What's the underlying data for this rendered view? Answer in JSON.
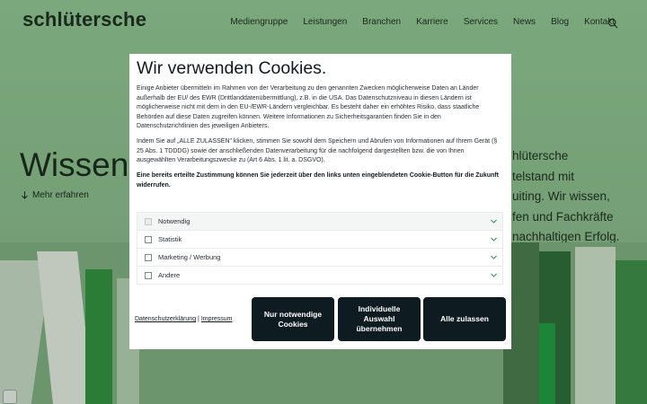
{
  "header": {
    "logo": "schlütersche",
    "nav": [
      "Mediengruppe",
      "Leistungen",
      "Branchen",
      "Karriere",
      "Services",
      "News",
      "Blog",
      "Kontakt"
    ]
  },
  "hero": {
    "title": "Wissen",
    "more_link": "Mehr erfahren",
    "side_lines": [
      "hlütersche",
      "telstand mit",
      "uiting. Wir wissen,",
      "fen und Fachkräfte",
      "nachhaltigen Erfolg."
    ]
  },
  "cookie_dialog": {
    "title": "Wir verwenden Cookies.",
    "paragraphs": [
      "Einige Anbieter übermitteln im Rahmen von der Verarbeitung zu den genannten Zwecken möglicherweise Daten an Länder außerhalb der EU/ des EWR (Drittlanddatenübermittlung), z.B. in die USA. Das Datenschutzniveau in diesen Ländern ist möglicherweise nicht mit dem in den EU-/EWR-Ländern vergleichbar. Es besteht daher ein erhöhtes Risiko, dass staatliche Behörden auf diese Daten zugreifen können. Weitere Informationen zu Sicherheitsgarantien finden Sie in den Datenschutzrichtlinien des jeweiligen Anbieters.",
      "Indem Sie auf „ALLE ZULASSEN\" klicken, stimmen Sie sowohl dem Speichern und Abrufen von Informationen auf Ihrem Gerät (§ 25 Abs. 1 TDDDG) sowie der anschließenden Datenverarbeitung für die nachfolgend dargestellten bzw. die von Ihnen ausgewählten Verarbeitungszwecke zu (Art 6 Abs. 1 lit. a. DSGVO).",
      "Eine bereits erteilte Zustimmung können Sie jederzeit über den links unten eingeblendeten Cookie-Button für die Zukunft widerrufen."
    ],
    "categories": [
      "Notwendig",
      "Statistik",
      "Marketing / Werbung",
      "Andere"
    ],
    "links": {
      "privacy": "Datenschutzerklärung",
      "separator": "|",
      "imprint": "Impressum"
    },
    "buttons": {
      "necessary": "Nur notwendige Cookies",
      "individual": "Individuelle Auswahl übernehmen",
      "accept_all": "Alle zulassen"
    }
  },
  "colors": {
    "background": "#8dbd8e",
    "button": "#0e1c22",
    "chevron": "#2f9a52",
    "text": "#101a20"
  }
}
